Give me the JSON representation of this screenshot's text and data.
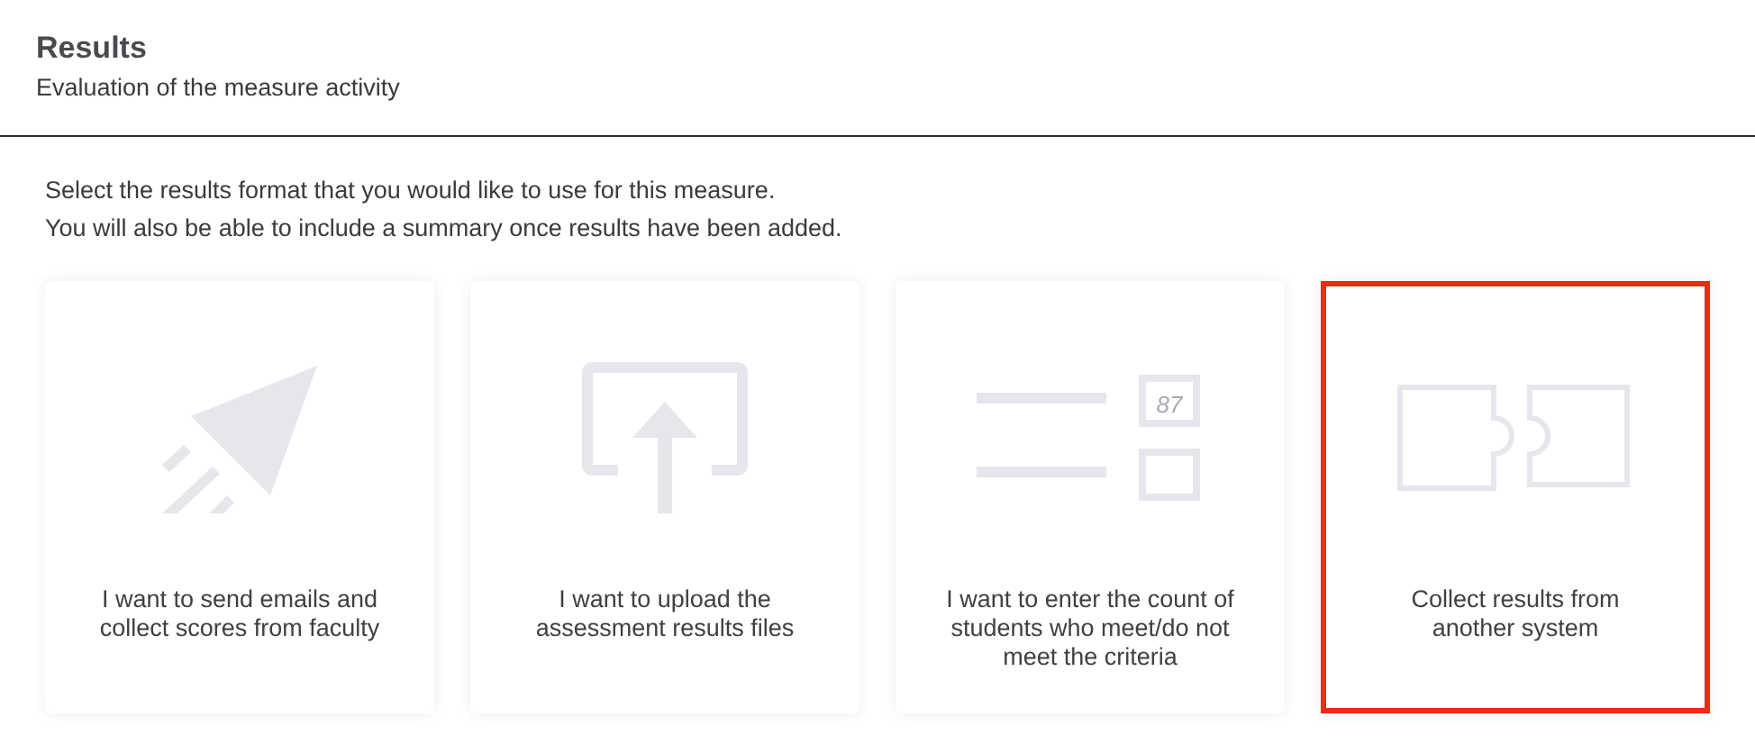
{
  "header": {
    "title": "Results",
    "subtitle": "Evaluation of the measure activity"
  },
  "intro": [
    "Select the results format that you would like to use for this measure.",
    "You will also be able to include a summary once results have been added."
  ],
  "options": [
    {
      "kind": "send",
      "label": "I want to send emails and collect scores from faculty",
      "highlighted": false
    },
    {
      "kind": "upload",
      "label": "I want to upload the assessment results files",
      "highlighted": false
    },
    {
      "kind": "count",
      "label": "I want to enter the count of students who meet/do not meet the criteria",
      "icon_number": "87",
      "highlighted": false
    },
    {
      "kind": "integrate",
      "label": "Collect results from another system",
      "highlighted": true
    }
  ]
}
